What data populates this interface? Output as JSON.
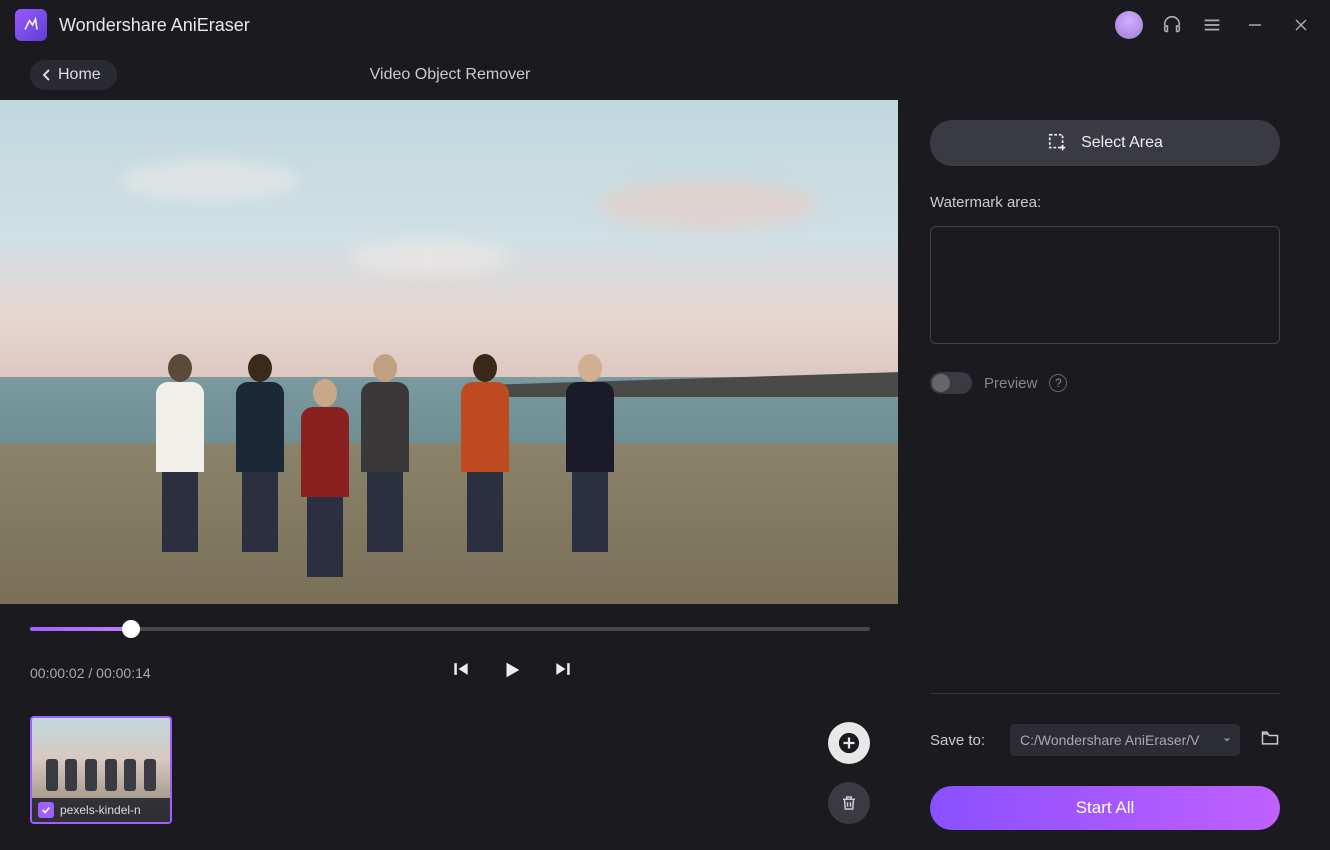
{
  "titlebar": {
    "app_name": "Wondershare AniEraser"
  },
  "subheader": {
    "home_label": "Home",
    "page_title": "Video Object Remover"
  },
  "player": {
    "current_time": "00:00:02",
    "total_time": "00:00:14",
    "progress_percent": 12
  },
  "thumbnail": {
    "filename": "pexels-kindel-n"
  },
  "side": {
    "select_area_label": "Select Area",
    "watermark_label": "Watermark area:",
    "preview_label": "Preview"
  },
  "save": {
    "label": "Save to:",
    "path": "C:/Wondershare AniEraser/V"
  },
  "start_label": "Start All"
}
